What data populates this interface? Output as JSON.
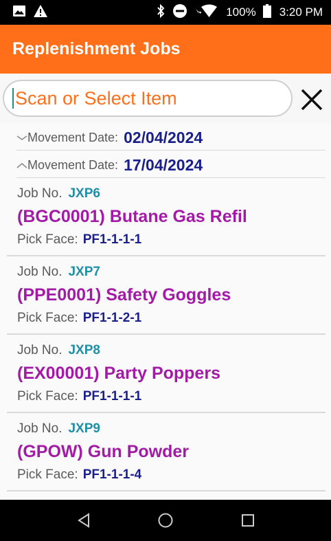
{
  "status_bar": {
    "battery": "100%",
    "time": "3:20 PM",
    "icons": [
      "image-icon",
      "warning-icon",
      "bluetooth-icon",
      "do-not-disturb-icon",
      "wifi-icon",
      "battery-icon"
    ]
  },
  "app_bar": {
    "title": "Replenishment Jobs",
    "color": "#ff6f1a"
  },
  "search": {
    "placeholder": "Scan or Select Item"
  },
  "date_groups": [
    {
      "label": "Movement Date:",
      "value": "02/04/2024",
      "state": "collapsed"
    },
    {
      "label": "Movement Date:",
      "value": "17/04/2024",
      "state": "expanded"
    }
  ],
  "jobs": [
    {
      "job_label": "Job No.",
      "job_no": "JXP6",
      "title": "(BGC0001) Butane Gas Refil",
      "pick_label": "Pick Face:",
      "pick_face": "PF1-1-1-1"
    },
    {
      "job_label": "Job No.",
      "job_no": "JXP7",
      "title": "(PPE0001) Safety Goggles",
      "pick_label": "Pick Face:",
      "pick_face": "PF1-1-2-1"
    },
    {
      "job_label": "Job No.",
      "job_no": "JXP8",
      "title": "(EX00001) Party Poppers",
      "pick_label": "Pick Face:",
      "pick_face": "PF1-1-1-1"
    },
    {
      "job_label": "Job No.",
      "job_no": "JXP9",
      "title": "(GPOW) Gun Powder",
      "pick_label": "Pick Face:",
      "pick_face": "PF1-1-1-4"
    }
  ],
  "nav_bar": {
    "icons": [
      "back-icon",
      "home-icon",
      "recents-icon"
    ]
  }
}
